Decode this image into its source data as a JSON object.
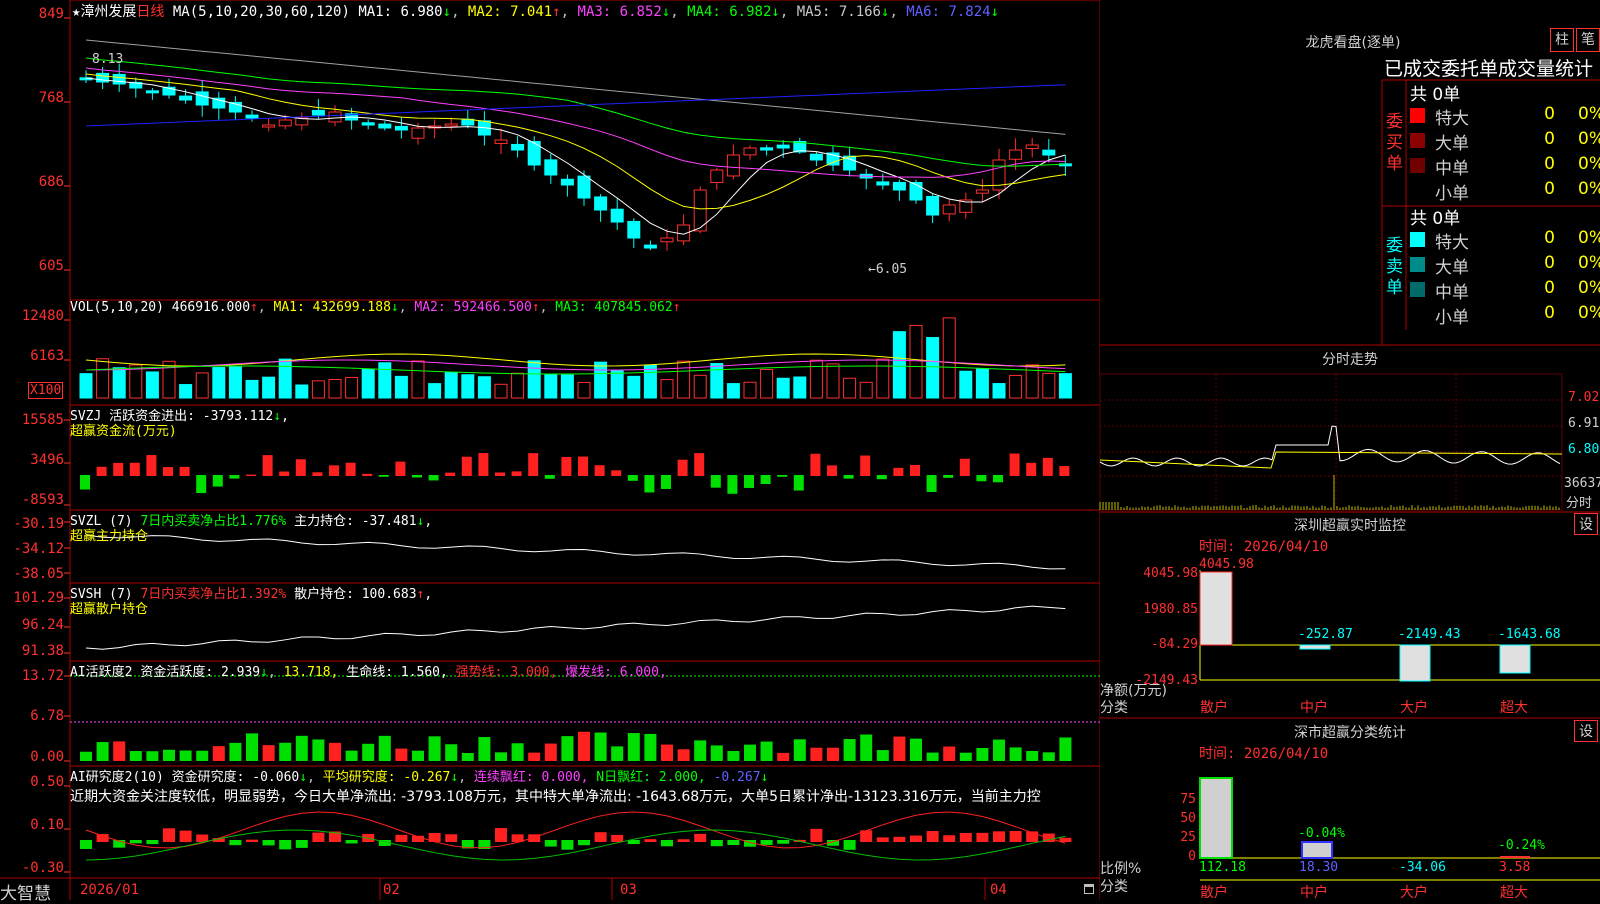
{
  "app": {
    "logo": "大智慧"
  },
  "main": {
    "title_star": "★",
    "stock_name": "漳州发展",
    "period": "日线",
    "ma_label": "MA(5,10,20,30,60,120)",
    "ma_values": [
      {
        "label": "MA1: 6.980",
        "arrow": "↓"
      },
      {
        "label": "MA2: 7.041",
        "arrow": "↑"
      },
      {
        "label": "MA3: 6.852",
        "arrow": "↓"
      },
      {
        "label": "MA4: 6.982",
        "arrow": "↓"
      },
      {
        "label": "MA5: 7.166",
        "arrow": "↓"
      },
      {
        "label": "MA6: 7.824",
        "arrow": "↓"
      }
    ],
    "y_ticks": [
      "849",
      "768",
      "686",
      "605"
    ],
    "high_label": "8.13",
    "low_label": "←6.05",
    "dates": [
      "2026/01",
      "02",
      "03",
      "04"
    ]
  },
  "vol": {
    "header": "VOL(5,10,20)",
    "value": "466916.000",
    "value_arrow": "↑",
    "ma1": "MA1: 432699.188",
    "ma1_arrow": "↓",
    "ma2": "MA2: 592466.500",
    "ma2_arrow": "↑",
    "ma3": "MA3: 407845.062",
    "ma3_arrow": "↑",
    "y_ticks": [
      "12480",
      "6163"
    ],
    "unit": "X100"
  },
  "svzj": {
    "header": "SVZJ",
    "line1": "活跃资金进出: -3793.112",
    "line1_arrow": "↓",
    "line1_end": ",",
    "line2": "超赢资金流(万元)",
    "y_ticks": [
      "15585",
      "3496",
      "-8593"
    ]
  },
  "svzl": {
    "header": "SVZL (7)",
    "line1a": "7日内买卖净占比1.776%",
    "line1b": "主力持仓: -37.481",
    "line1_arrow": "↓",
    "line1_end": ",",
    "line2": "超赢主力持仓",
    "y_ticks": [
      "-30.19",
      "-34.12",
      "-38.05"
    ]
  },
  "svsh": {
    "header": "SVSH (7)",
    "line1a": "7日内买卖净占比1.392%",
    "line1b": "散户持仓: 100.683",
    "line1_arrow": "↑",
    "line1_end": ",",
    "line2": "超赢散户持仓",
    "y_ticks": [
      "101.29",
      "96.24",
      "91.38"
    ]
  },
  "ai1": {
    "header": "AI活跃度2",
    "a": "资金活跃度: 2.939",
    "a_arrow": "↓",
    "b": "13.718,",
    "c": "生命线: 1.560,",
    "d": "强势线: 3.000,",
    "e": "爆发线: 6.000,",
    "y_ticks": [
      "13.72",
      "6.78",
      "0.00"
    ]
  },
  "ai2": {
    "header": "AI研究度2(10)",
    "a": "资金研究度: -0.060",
    "a_arrow": "↓",
    "b": "平均研究度: -0.267",
    "b_arrow": "↓",
    "c": "连续飘红: 0.000,",
    "d": "N日飘红: 2.000,",
    "e": "-0.267",
    "e_arrow": "↓",
    "text": "近期大资金关注度较低，明显弱势，今日大单净流出: -3793.108万元，其中特大单净流出: -1643.68万元，大单5日累计净出-13123.316万元，当前主力控",
    "y_ticks": [
      "0.50",
      "0.10",
      "-0.30"
    ]
  },
  "right": {
    "longhu_title": "龙虎看盘(逐单)",
    "btn_zhu": "柱",
    "btn_bi": "笔",
    "stat_title": "已成交委托单成交量统计",
    "buy_label": "委买单",
    "sell_label": "委卖单",
    "buy_total": "共 0单",
    "sell_total": "共 0单",
    "buy_rows": [
      {
        "name": "特大",
        "n": "0",
        "p": "0%",
        "color": "#ff0000"
      },
      {
        "name": "大单",
        "n": "0",
        "p": "0%",
        "color": "#8b0000"
      },
      {
        "name": "中单",
        "n": "0",
        "p": "0%",
        "color": "#700000"
      },
      {
        "name": "小单",
        "n": "0",
        "p": "0%",
        "color": "#000000"
      }
    ],
    "sell_rows": [
      {
        "name": "特大",
        "n": "0",
        "p": "0%",
        "color": "#00ffff"
      },
      {
        "name": "大单",
        "n": "0",
        "p": "0%",
        "color": "#008b8b"
      },
      {
        "name": "中单",
        "n": "0",
        "p": "0%",
        "color": "#006b6b"
      },
      {
        "name": "小单",
        "n": "0",
        "p": "0%",
        "color": "#000000"
      }
    ],
    "intraday_title": "分时走势",
    "intraday_ticks": [
      "7.02",
      "6.91",
      "6.80"
    ],
    "intraday_vol": "36637",
    "intraday_vol_label": "分时",
    "sz_title": "深圳超赢实时监控",
    "sz_time": "时间: 2026/04/10",
    "sz_set": "设",
    "sz_ticks": [
      "4045.98",
      "1980.85",
      "-84.29",
      "-2149.43"
    ],
    "sz_bar_labels": [
      "4045.98",
      "-252.87",
      "-2149.43",
      "-1643.68"
    ],
    "sz_ylabel": "净额(万元)",
    "sz_xlabel": "分类",
    "sz_cats": [
      "散户",
      "中户",
      "大户",
      "超大"
    ],
    "cls_title": "深市超赢分类统计",
    "cls_time": "时间: 2026/04/10",
    "cls_set": "设",
    "cls_ticks": [
      "75",
      "50",
      "25",
      "0"
    ],
    "cls_top_labels": [
      "-0.04%",
      "-0.24%"
    ],
    "cls_values": [
      "112.18",
      "18.30",
      "-34.06",
      "3.58"
    ],
    "cls_ylabel": "比例%",
    "cls_xlabel": "分类",
    "cls_cats": [
      "散户",
      "中户",
      "大户",
      "超大"
    ]
  }
}
